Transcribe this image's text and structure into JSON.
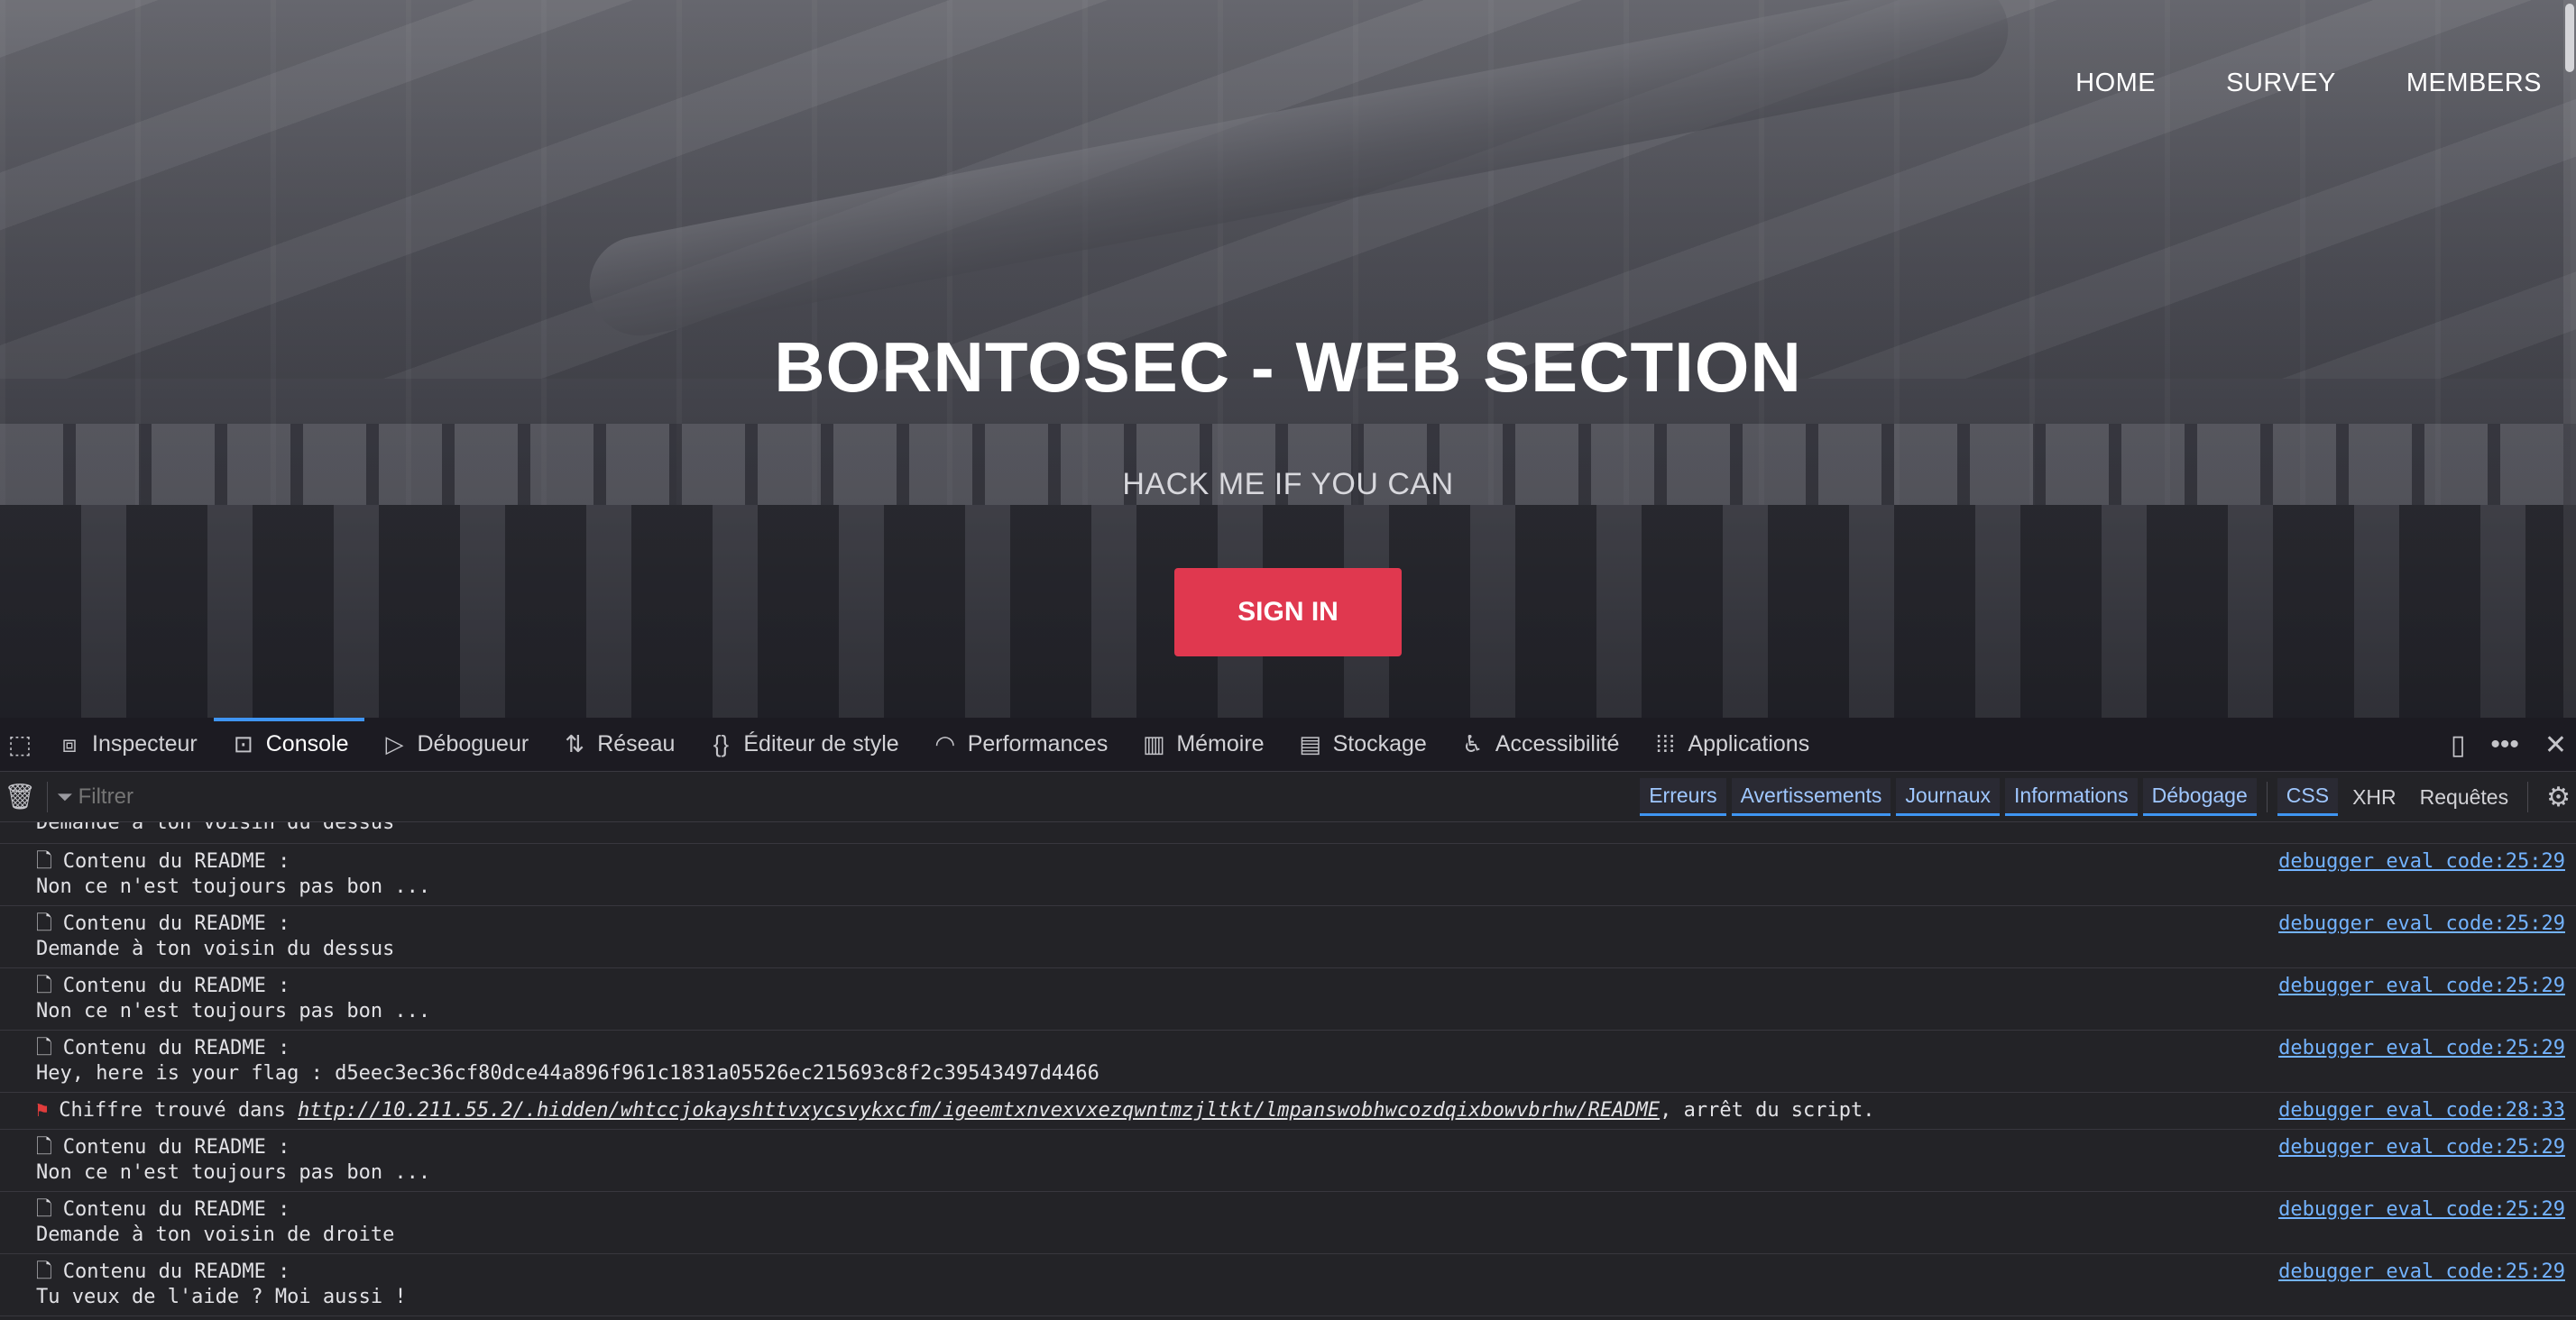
{
  "website": {
    "nav": [
      "HOME",
      "SURVEY",
      "MEMBERS"
    ],
    "title": "BORNTOSEC - WEB SECTION",
    "subtitle": "HACK ME IF YOU CAN",
    "signin_label": "SIGN IN"
  },
  "devtools": {
    "tabs": [
      {
        "label": "Inspecteur",
        "icon": "inspector-icon"
      },
      {
        "label": "Console",
        "icon": "console-icon",
        "active": true
      },
      {
        "label": "Débogueur",
        "icon": "debugger-icon"
      },
      {
        "label": "Réseau",
        "icon": "network-icon"
      },
      {
        "label": "Éditeur de style",
        "icon": "style-editor-icon"
      },
      {
        "label": "Performances",
        "icon": "performance-icon"
      },
      {
        "label": "Mémoire",
        "icon": "memory-icon"
      },
      {
        "label": "Stockage",
        "icon": "storage-icon"
      },
      {
        "label": "Accessibilité",
        "icon": "accessibility-icon"
      },
      {
        "label": "Applications",
        "icon": "applications-icon"
      }
    ],
    "filter_placeholder": "Filtrer",
    "levels": [
      "Erreurs",
      "Avertissements",
      "Journaux",
      "Informations",
      "Débogage"
    ],
    "extra_filters": [
      "CSS",
      "XHR",
      "Requêtes"
    ],
    "partial_message": "Demande à ton voisin du dessus",
    "messages": [
      {
        "type": "log",
        "header": "Contenu du README :",
        "body": "Non ce n'est toujours pas bon ...",
        "source": "debugger eval code:25:29"
      },
      {
        "type": "log",
        "header": "Contenu du README :",
        "body": "Demande à ton voisin du dessus",
        "source": "debugger eval code:25:29"
      },
      {
        "type": "log",
        "header": "Contenu du README :",
        "body": "Non ce n'est toujours pas bon ...",
        "source": "debugger eval code:25:29"
      },
      {
        "type": "log",
        "header": "Contenu du README :",
        "body": "Hey, here is your flag : d5eec3ec36cf80dce44a896f961c1831a05526ec215693c8f2c39543497d4466",
        "source": "debugger eval code:25:29"
      },
      {
        "type": "error",
        "prefix": "Chiffre trouvé dans ",
        "link": "http://10.211.55.2/.hidden/whtccjokayshttvxycsvykxcfm/igeemtxnvexvxezqwntmzjltkt/lmpanswobhwcozdqixbowvbrhw/README",
        "suffix": ", arrêt du script.",
        "source": "debugger eval code:28:33"
      },
      {
        "type": "log",
        "header": "Contenu du README :",
        "body": "Non ce n'est toujours pas bon ...",
        "source": "debugger eval code:25:29"
      },
      {
        "type": "log",
        "header": "Contenu du README :",
        "body": "Demande à ton voisin de droite",
        "source": "debugger eval code:25:29"
      },
      {
        "type": "log",
        "header": "Contenu du README :",
        "body": "Tu veux de l'aide ? Moi aussi !",
        "source": "debugger eval code:25:29"
      }
    ]
  }
}
